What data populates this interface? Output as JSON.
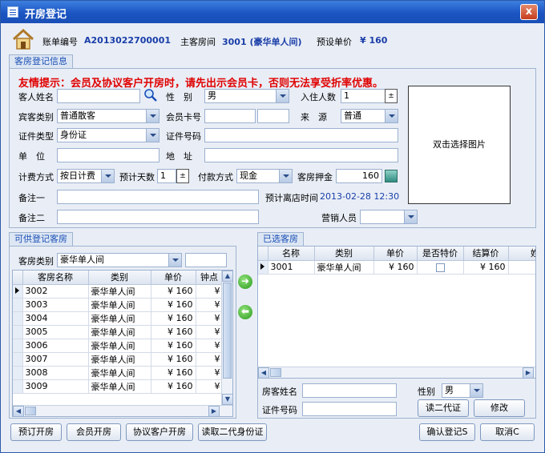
{
  "window": {
    "title": "开房登记",
    "close": "x"
  },
  "info": {
    "bill_label": "账单编号",
    "bill_value": "A2013022700001",
    "room_label": "主客房间",
    "room_value": "3001 (豪华单人间)",
    "price_label": "预设单价",
    "price_value": "¥ 160"
  },
  "reg": {
    "tab": "客房登记信息",
    "notice": "友情提示：会员及协议客户开房时，请先出示会员卡，否则无法享受折率优惠。",
    "guest_name_label": "客人姓名",
    "guest_name": "",
    "gender_label": "性　别",
    "gender": "男",
    "occupants_label": "入住人数",
    "occupants": "1",
    "guest_type_label": "宾客类别",
    "guest_type": "普通散客",
    "member_card_label": "会员卡号",
    "member_card": "",
    "member_card_extra": "",
    "source_label": "来　源",
    "source": "普通",
    "id_type_label": "证件类型",
    "id_type": "身份证",
    "id_no_label": "证件号码",
    "id_no": "",
    "unit_label": "单　位",
    "unit": "",
    "address_label": "地　址",
    "address": "",
    "billing_label": "计费方式",
    "billing": "按日计费",
    "days_label": "预计天数",
    "days": "1",
    "payment_label": "付款方式",
    "payment": "现金",
    "deposit_label": "客房押金",
    "deposit": "160",
    "note1_label": "备注一",
    "note1": "",
    "checkout_label": "预计离店时间",
    "checkout": "2013-02-28 12:30",
    "note2_label": "备注二",
    "note2": "",
    "sales_label": "营销人员",
    "sales": "",
    "photo": "双击选择图片"
  },
  "available": {
    "tab": "可供登记客房",
    "type_label": "客房类别",
    "type_value": "豪华单人间",
    "type_extra": "",
    "columns": [
      "客房名称",
      "类别",
      "单价",
      "钟点"
    ],
    "rows": [
      [
        "3002",
        "豪华单人间",
        "¥ 160",
        "¥"
      ],
      [
        "3003",
        "豪华单人间",
        "¥ 160",
        "¥"
      ],
      [
        "3004",
        "豪华单人间",
        "¥ 160",
        "¥"
      ],
      [
        "3005",
        "豪华单人间",
        "¥ 160",
        "¥"
      ],
      [
        "3006",
        "豪华单人间",
        "¥ 160",
        "¥"
      ],
      [
        "3007",
        "豪华单人间",
        "¥ 160",
        "¥"
      ],
      [
        "3008",
        "豪华单人间",
        "¥ 160",
        "¥"
      ],
      [
        "3009",
        "豪华单人间",
        "¥ 160",
        "¥"
      ]
    ]
  },
  "selected": {
    "tab": "已选客房",
    "columns": [
      "名称",
      "类别",
      "单价",
      "是否特价",
      "结算价",
      "姓名"
    ],
    "rows": [
      [
        "3001",
        "豪华单人间",
        "¥ 160",
        "",
        "¥ 160",
        ""
      ]
    ],
    "guest_name_label": "房客姓名",
    "guest_name": "",
    "gender_label": "性别",
    "gender": "男",
    "id_no_label": "证件号码",
    "id_no": "",
    "read_id_btn": "读二代证",
    "modify_btn": "修改"
  },
  "buttons": {
    "reserve": "预订开房",
    "member": "会员开房",
    "agreement": "协议客户开房",
    "read_id": "读取二代身份证",
    "confirm": "确认登记S",
    "cancel": "取消C"
  }
}
